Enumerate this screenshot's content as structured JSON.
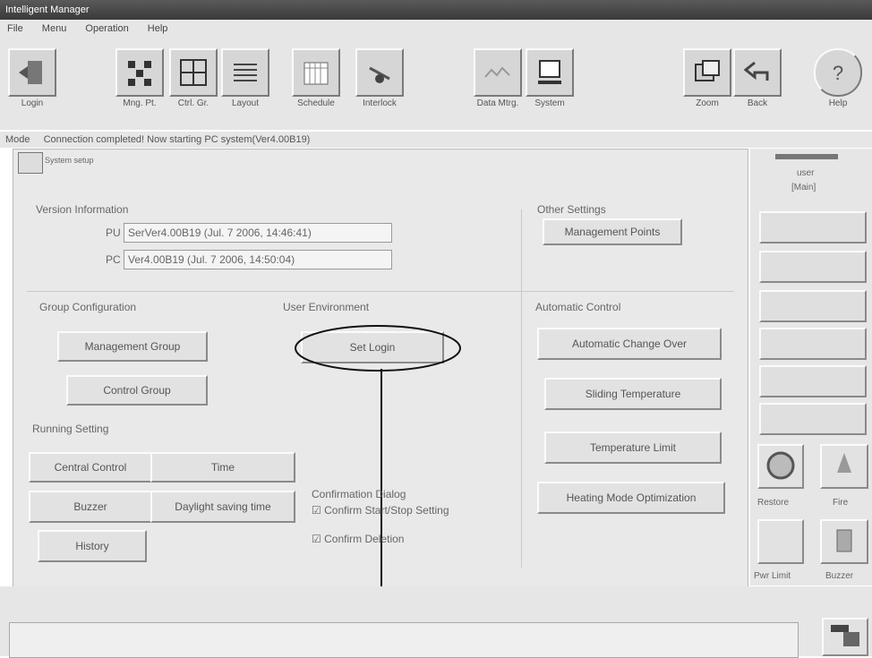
{
  "window": {
    "title": "Intelligent Manager"
  },
  "menu": [
    "File",
    "Menu",
    "Operation",
    "Help"
  ],
  "toolbar": {
    "buttons": [
      {
        "label": "Login",
        "icon": "login-door-icon"
      },
      {
        "label": "Mng. Pt.",
        "icon": "management-point-icon"
      },
      {
        "label": "Ctrl. Gr.",
        "icon": "control-group-icon"
      },
      {
        "label": "Layout",
        "icon": "layout-icon"
      },
      {
        "label": "Schedule",
        "icon": "schedule-icon"
      },
      {
        "label": "Interlock",
        "icon": "interlock-icon"
      },
      {
        "label": "Data Mtrg.",
        "icon": "data-monitoring-icon"
      },
      {
        "label": "System",
        "icon": "system-computer-icon"
      },
      {
        "label": "Zoom",
        "icon": "zoom-icon"
      },
      {
        "label": "Back",
        "icon": "back-arrow-icon"
      },
      {
        "label": "Help",
        "icon": "help-icon"
      }
    ]
  },
  "status": {
    "mode_label": "Mode",
    "message": "Connection completed! Now starting PC system(Ver4.00B19)"
  },
  "panel": {
    "title": "System setup",
    "version": {
      "heading": "Version Information",
      "pu_label": "PU",
      "pu_value": "SerVer4.00B19 (Jul. 7 2006, 14:46:41)",
      "pc_label": "PC",
      "pc_value": "Ver4.00B19 (Jul. 7 2006, 14:50:04)"
    },
    "other": {
      "heading": "Other Settings",
      "management_points": "Management Points"
    },
    "group": {
      "heading": "Group Configuration",
      "management_group": "Management Group",
      "control_group": "Control Group"
    },
    "user_env": {
      "heading": "User Environment",
      "set_login": "Set Login"
    },
    "auto": {
      "heading": "Automatic Control",
      "change_over": "Automatic Change Over",
      "sliding_temp": "Sliding Temperature",
      "temp_limit": "Temperature Limit",
      "heating_opt": "Heating Mode Optimization"
    },
    "running": {
      "heading": "Running Setting",
      "central_control": "Central Control",
      "time": "Time",
      "buzzer": "Buzzer",
      "daylight": "Daylight saving time",
      "history": "History"
    },
    "confirm": {
      "heading": "Confirmation Dialog",
      "start_stop": "Confirm Start/Stop Setting",
      "deletion": "Confirm Deletion"
    }
  },
  "right_panel": {
    "user_label": "user",
    "user_name": "[Main]",
    "restore": "Restore",
    "fire": "Fire",
    "pwr_limit": "Pwr Limit",
    "buzzer": "Buzzer"
  }
}
